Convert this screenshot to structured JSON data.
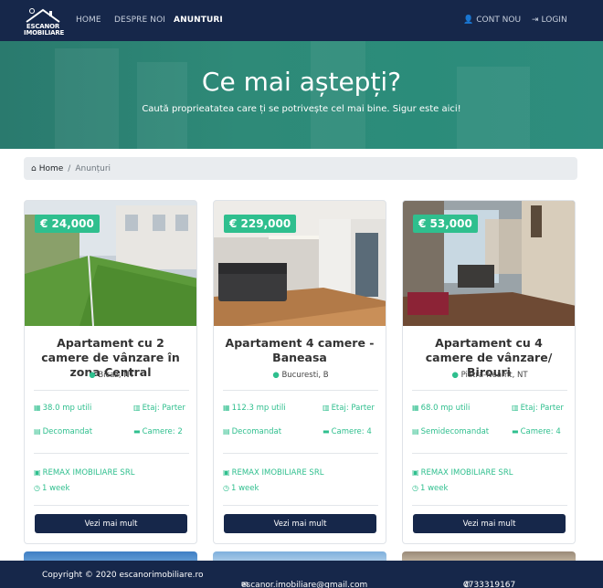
{
  "brand": {
    "logo_line1": "ESCANOR",
    "logo_line2": "IMOBILIARE"
  },
  "nav": {
    "home": "HOME",
    "about": "DESPRE NOI",
    "listings": "ANUNTURI",
    "account": "CONT NOU",
    "login": "LOGIN"
  },
  "hero": {
    "title": "Ce mai aștepți?",
    "subtitle": "Caută proprieatatea care ți se potrivește cel mai bine. Sigur este aici!"
  },
  "breadcrumb": {
    "home": "Home",
    "current": "Anunțuri"
  },
  "cards": [
    {
      "price": "€ 24,000",
      "title": "Apartament cu 2 camere de vânzare în zona Central",
      "location": "Bicaz, NT",
      "area": "38.0 mp utili",
      "floor": "Etaj: Parter",
      "layout": "Decomandat",
      "rooms": "Camere: 2",
      "agency": "REMAX IMOBILIARE SRL",
      "time": "1 week",
      "button": "Vezi mai mult"
    },
    {
      "price": "€ 229,000",
      "title": "Apartament 4 camere - Baneasa",
      "location": "Bucuresti, B",
      "area": "112.3 mp utili",
      "floor": "Etaj: Parter",
      "layout": "Decomandat",
      "rooms": "Camere: 4",
      "agency": "REMAX IMOBILIARE SRL",
      "time": "1 week",
      "button": "Vezi mai mult"
    },
    {
      "price": "€ 53,000",
      "title": "Apartament cu 4 camere de vânzare/ Birouri",
      "location": "Piatra-Neamt, NT",
      "area": "68.0 mp utili",
      "floor": "Etaj: Parter",
      "layout": "Semidecomandat",
      "rooms": "Camere: 4",
      "agency": "REMAX IMOBILIARE SRL",
      "time": "1 week",
      "button": "Vezi mai mult"
    }
  ],
  "footer": {
    "copyright": "Copyright © 2020 escanorimobiliare.ro",
    "email": "escanor.imobiliare@gmail.com",
    "phone": "0733319167"
  },
  "colors": {
    "navy": "#16274a",
    "accent": "#2fbf8e",
    "hero": "#2b8c7a"
  }
}
